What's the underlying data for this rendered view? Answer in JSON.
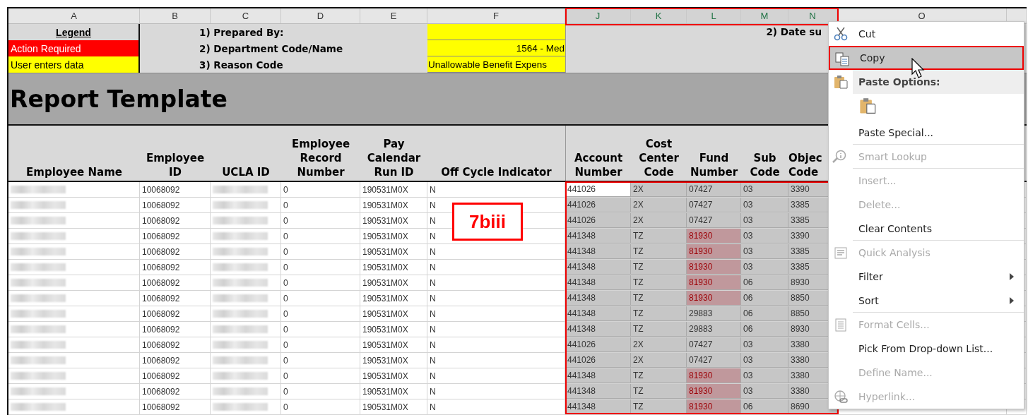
{
  "column_headers": [
    {
      "label": "A",
      "selected": false
    },
    {
      "label": "B",
      "selected": false
    },
    {
      "label": "C",
      "selected": false
    },
    {
      "label": "D",
      "selected": false
    },
    {
      "label": "E",
      "selected": false
    },
    {
      "label": "F",
      "selected": false
    },
    {
      "label": "J",
      "selected": true
    },
    {
      "label": "K",
      "selected": true
    },
    {
      "label": "L",
      "selected": true
    },
    {
      "label": "M",
      "selected": true
    },
    {
      "label": "N",
      "selected": true
    },
    {
      "label": "O",
      "selected": false
    }
  ],
  "legend": {
    "title": "Legend",
    "items": [
      {
        "label": "Action Required",
        "color": "#ff0000"
      },
      {
        "label": "User enters data",
        "color": "#ffff00"
      }
    ]
  },
  "form_fields": [
    {
      "label": "1) Prepared By:"
    },
    {
      "label": "2) Department Code/Name",
      "value": "1564 - Med"
    },
    {
      "label": "3) Reason Code",
      "value": "Unallowable Benefit Expens"
    }
  ],
  "date_label": "2) Date su",
  "title": "Report Template",
  "table": {
    "columns": [
      "Employee Name",
      "Employee ID",
      "UCLA ID",
      "Employee Record Number",
      "Pay Calendar Run ID",
      "Off Cycle Indicator",
      "Account Number",
      "Cost Center Code",
      "Fund Number",
      "Sub Code",
      "Objec Code"
    ],
    "rows": [
      {
        "employee_id": "10068092",
        "record": "0",
        "run_id": "190531M0X",
        "off_cycle": "N",
        "account": "441026",
        "cost_center": "2X",
        "fund": "07427",
        "sub": "03",
        "object": "3390",
        "fund_flagged": false,
        "selected": true,
        "active": true
      },
      {
        "employee_id": "10068092",
        "record": "0",
        "run_id": "190531M0X",
        "off_cycle": "N",
        "account": "441026",
        "cost_center": "2X",
        "fund": "07427",
        "sub": "03",
        "object": "3385",
        "fund_flagged": false,
        "selected": true,
        "active": false
      },
      {
        "employee_id": "10068092",
        "record": "0",
        "run_id": "190531M0X",
        "off_cycle": "N",
        "account": "441026",
        "cost_center": "2X",
        "fund": "07427",
        "sub": "03",
        "object": "3385",
        "fund_flagged": false,
        "selected": true,
        "active": false
      },
      {
        "employee_id": "10068092",
        "record": "0",
        "run_id": "190531M0X",
        "off_cycle": "N",
        "account": "441348",
        "cost_center": "TZ",
        "fund": "81930",
        "sub": "03",
        "object": "3390",
        "fund_flagged": true,
        "selected": true,
        "active": false
      },
      {
        "employee_id": "10068092",
        "record": "0",
        "run_id": "190531M0X",
        "off_cycle": "N",
        "account": "441348",
        "cost_center": "TZ",
        "fund": "81930",
        "sub": "03",
        "object": "3385",
        "fund_flagged": true,
        "selected": true,
        "active": false
      },
      {
        "employee_id": "10068092",
        "record": "0",
        "run_id": "190531M0X",
        "off_cycle": "N",
        "account": "441348",
        "cost_center": "TZ",
        "fund": "81930",
        "sub": "03",
        "object": "3385",
        "fund_flagged": true,
        "selected": true,
        "active": false
      },
      {
        "employee_id": "10068092",
        "record": "0",
        "run_id": "190531M0X",
        "off_cycle": "N",
        "account": "441348",
        "cost_center": "TZ",
        "fund": "81930",
        "sub": "06",
        "object": "8930",
        "fund_flagged": true,
        "selected": true,
        "active": false
      },
      {
        "employee_id": "10068092",
        "record": "0",
        "run_id": "190531M0X",
        "off_cycle": "N",
        "account": "441348",
        "cost_center": "TZ",
        "fund": "81930",
        "sub": "06",
        "object": "8850",
        "fund_flagged": true,
        "selected": true,
        "active": false
      },
      {
        "employee_id": "10068092",
        "record": "0",
        "run_id": "190531M0X",
        "off_cycle": "N",
        "account": "441348",
        "cost_center": "TZ",
        "fund": "29883",
        "sub": "06",
        "object": "8850",
        "fund_flagged": false,
        "selected": true,
        "active": false
      },
      {
        "employee_id": "10068092",
        "record": "0",
        "run_id": "190531M0X",
        "off_cycle": "N",
        "account": "441348",
        "cost_center": "TZ",
        "fund": "29883",
        "sub": "06",
        "object": "8930",
        "fund_flagged": false,
        "selected": true,
        "active": false
      },
      {
        "employee_id": "10068092",
        "record": "0",
        "run_id": "190531M0X",
        "off_cycle": "N",
        "account": "441026",
        "cost_center": "2X",
        "fund": "07427",
        "sub": "03",
        "object": "3380",
        "fund_flagged": false,
        "selected": true,
        "active": false
      },
      {
        "employee_id": "10068092",
        "record": "0",
        "run_id": "190531M0X",
        "off_cycle": "N",
        "account": "441026",
        "cost_center": "2X",
        "fund": "07427",
        "sub": "03",
        "object": "3380",
        "fund_flagged": false,
        "selected": true,
        "active": false
      },
      {
        "employee_id": "10068092",
        "record": "0",
        "run_id": "190531M0X",
        "off_cycle": "N",
        "account": "441348",
        "cost_center": "TZ",
        "fund": "81930",
        "sub": "03",
        "object": "3380",
        "fund_flagged": true,
        "selected": true,
        "active": false
      },
      {
        "employee_id": "10068092",
        "record": "0",
        "run_id": "190531M0X",
        "off_cycle": "N",
        "account": "441348",
        "cost_center": "TZ",
        "fund": "81930",
        "sub": "03",
        "object": "3380",
        "fund_flagged": true,
        "selected": true,
        "active": false
      },
      {
        "employee_id": "10068092",
        "record": "0",
        "run_id": "190531M0X",
        "off_cycle": "N",
        "account": "441348",
        "cost_center": "TZ",
        "fund": "81930",
        "sub": "06",
        "object": "8690",
        "fund_flagged": true,
        "selected": true,
        "active": false
      }
    ]
  },
  "annotation_label": "7biii",
  "context_menu": [
    {
      "label": "Cut",
      "kind": "item",
      "disabled": false,
      "selected": false,
      "submenu": false,
      "separator_after": false
    },
    {
      "label": "Copy",
      "kind": "item",
      "disabled": false,
      "selected": true,
      "submenu": false,
      "separator_after": false
    },
    {
      "label": "Paste Options:",
      "kind": "header"
    },
    {
      "kind": "paste-icons"
    },
    {
      "label": "Paste Special...",
      "kind": "item",
      "disabled": false,
      "selected": false,
      "submenu": false,
      "separator_after": true
    },
    {
      "label": "Smart Lookup",
      "kind": "item",
      "disabled": true,
      "selected": false,
      "submenu": false,
      "separator_after": true
    },
    {
      "label": "Insert...",
      "kind": "item",
      "disabled": true,
      "selected": false,
      "submenu": false,
      "separator_after": false
    },
    {
      "label": "Delete...",
      "kind": "item",
      "disabled": true,
      "selected": false,
      "submenu": false,
      "separator_after": false
    },
    {
      "label": "Clear Contents",
      "kind": "item",
      "disabled": false,
      "selected": false,
      "submenu": false,
      "separator_after": true
    },
    {
      "label": "Quick Analysis",
      "kind": "item",
      "disabled": true,
      "selected": false,
      "submenu": false,
      "separator_after": false
    },
    {
      "label": "Filter",
      "kind": "item",
      "disabled": false,
      "selected": false,
      "submenu": true,
      "separator_after": false
    },
    {
      "label": "Sort",
      "kind": "item",
      "disabled": false,
      "selected": false,
      "submenu": true,
      "separator_after": true
    },
    {
      "label": "Format Cells...",
      "kind": "item",
      "disabled": true,
      "selected": false,
      "submenu": false,
      "separator_after": false
    },
    {
      "label": "Pick From Drop-down List...",
      "kind": "item",
      "disabled": false,
      "selected": false,
      "submenu": false,
      "separator_after": false
    },
    {
      "label": "Define Name...",
      "kind": "item",
      "disabled": true,
      "selected": false,
      "submenu": false,
      "separator_after": false
    },
    {
      "label": "Hyperlink...",
      "kind": "item",
      "disabled": true,
      "selected": false,
      "submenu": false,
      "separator_after": false
    }
  ]
}
